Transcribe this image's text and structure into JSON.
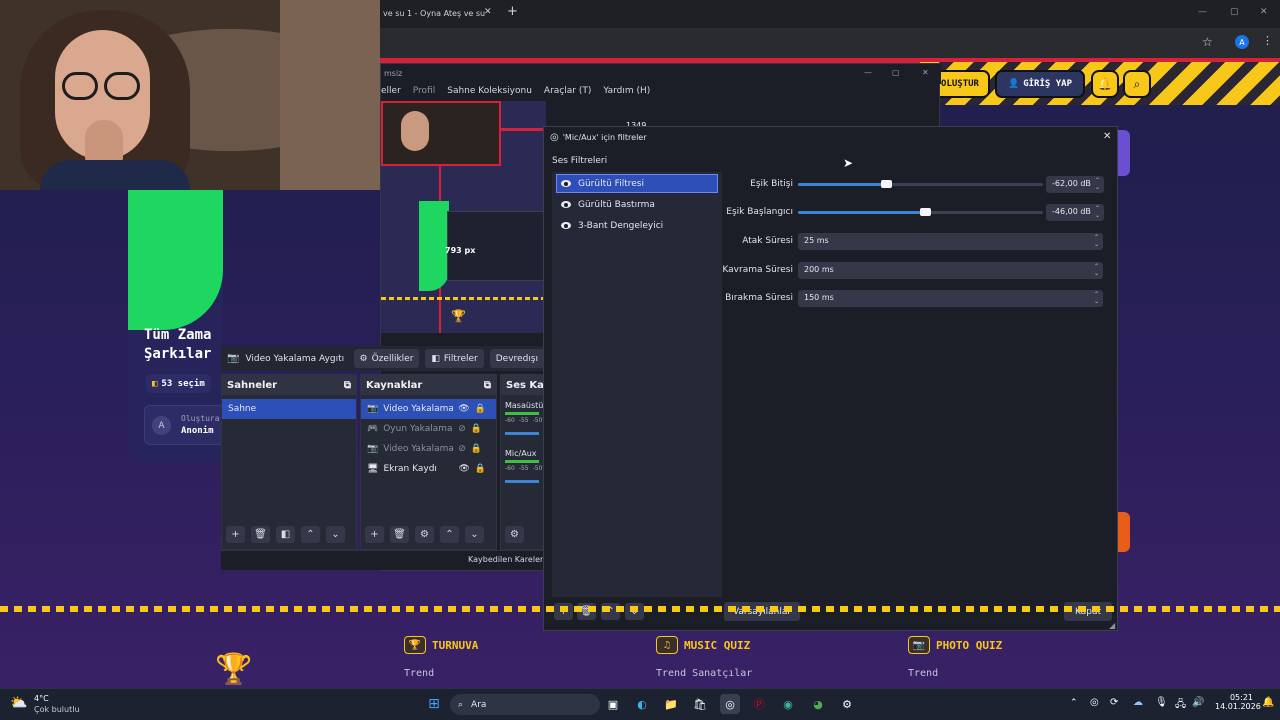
{
  "browser": {
    "tab_title": "ve su 1 - Oyna Ateş ve su",
    "tab_close": "✕",
    "new_tab": "+",
    "window_controls": [
      "—",
      "▢",
      "✕"
    ],
    "profile_initial": "A",
    "create_button": "OLUŞTUR",
    "login_button": "GİRİŞ YAP"
  },
  "site_card": {
    "title_line1": "Tüm Zama",
    "title_line2": "Şarkılar",
    "selection_count": "53 seçim",
    "created_label": "Oluştura",
    "author": "Anonim",
    "author_initial": "A"
  },
  "obs": {
    "window_title": "msiz",
    "window_controls": [
      "—",
      "▢",
      "✕"
    ],
    "menu": [
      "eller",
      "Profil",
      "Sahne Koleksiyonu",
      "Araçlar (T)",
      "Yardım (H)"
    ],
    "preview_width_label": "1349 px",
    "preview_height_label": "793 px",
    "source_bar": {
      "source_name": "Video Yakalama Aygıtı",
      "properties": "Özellikler",
      "filters": "Filtreler",
      "disable": "Devredışı"
    },
    "scenes": {
      "header": "Sahneler",
      "items": [
        "Sahne"
      ]
    },
    "sources": {
      "header": "Kaynaklar",
      "items": [
        {
          "name": "Video Yakalama A",
          "icon": "camera-icon",
          "visible": true
        },
        {
          "name": "Oyun Yakalama",
          "icon": "gamepad-icon",
          "visible": false
        },
        {
          "name": "Video Yakalama A",
          "icon": "camera-icon",
          "visible": false
        },
        {
          "name": "Ekran Kaydı",
          "icon": "monitor-icon",
          "visible": true
        }
      ]
    },
    "mixer": {
      "header": "Ses Karı",
      "channels": [
        "Masaüstü",
        "Mic/Aux"
      ],
      "scale": [
        "-60",
        "-55",
        "-50"
      ]
    },
    "status": "Kaybedilen Kareler"
  },
  "filters_dialog": {
    "title": "'Mic/Aux' için filtreler",
    "close": "✕",
    "section_label": "Ses Filtreleri",
    "filters": [
      "Gürültü Filtresi",
      "Gürültü Bastırma",
      "3-Bant Dengeleyici"
    ],
    "selected_filter_index": 0,
    "properties": [
      {
        "label": "Eşik Bitişi",
        "value": "-62,00 dB",
        "slider_level": 0.36
      },
      {
        "label": "Eşik Başlangıcı",
        "value": "-46,00 dB",
        "slider_level": 0.52
      },
      {
        "label": "Atak Süresi",
        "value": "25 ms"
      },
      {
        "label": "Kavrama Süresi",
        "value": "200 ms"
      },
      {
        "label": "Bırakma Süresi",
        "value": "150 ms"
      }
    ],
    "defaults_button": "Varsayılanlar",
    "close_button": "Kapat"
  },
  "footer": {
    "columns": [
      {
        "title": "TURNUVA",
        "icon": "trophy-icon",
        "links": [
          "Trend"
        ]
      },
      {
        "title": "MUSIC QUIZ",
        "icon": "music-icon",
        "links": [
          "Trend Sanatçılar"
        ]
      },
      {
        "title": "PHOTO QUIZ",
        "icon": "camera-icon",
        "links": [
          "Trend"
        ]
      }
    ]
  },
  "taskbar": {
    "weather_temp": "4°C",
    "weather_desc": "Çok bulutlu",
    "search_placeholder": "Ara",
    "time": "05:21",
    "date": "14.01.2026"
  }
}
